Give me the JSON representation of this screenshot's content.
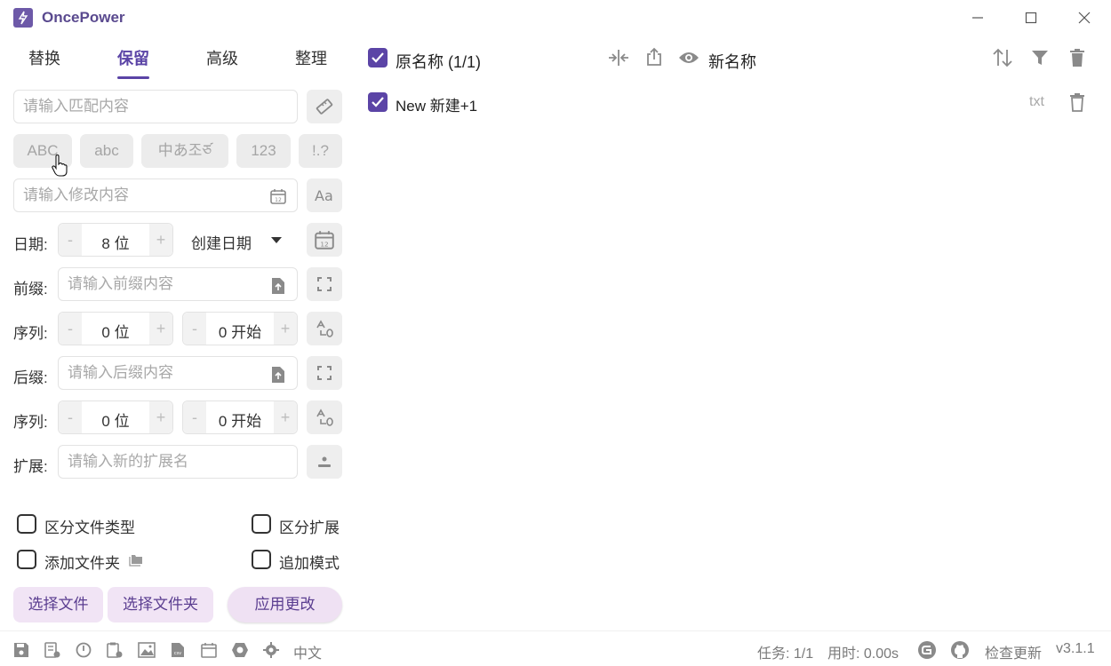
{
  "app": {
    "title": "OncePower",
    "version": "v3.1.1"
  },
  "tabs": [
    {
      "label": "替换"
    },
    {
      "label": "保留"
    },
    {
      "label": "高级"
    },
    {
      "label": "整理"
    }
  ],
  "active_tab": "保留",
  "match_input": {
    "placeholder": "请输入匹配内容",
    "value": ""
  },
  "chips": [
    "ABC",
    "abc",
    "中あ조ཙ",
    "123",
    "!.?"
  ],
  "modify_input": {
    "placeholder": "请输入修改内容",
    "value": ""
  },
  "date": {
    "label": "日期:",
    "minus": "-",
    "value": "8 位",
    "plus": "+",
    "type_selected": "创建日期"
  },
  "prefix": {
    "label": "前缀:",
    "placeholder": "请输入前缀内容"
  },
  "prefix_seq": {
    "label": "序列:",
    "digits": "0 位",
    "start": "0 开始",
    "minus": "-",
    "plus": "+"
  },
  "suffix": {
    "label": "后缀:",
    "placeholder": "请输入后缀内容"
  },
  "suffix_seq": {
    "label": "序列:",
    "digits": "0 位",
    "start": "0 开始",
    "minus": "-",
    "plus": "+"
  },
  "extension": {
    "label": "扩展:",
    "placeholder": "请输入新的扩展名"
  },
  "options": {
    "distinguish_file_type": "区分文件类型",
    "distinguish_extension": "区分扩展",
    "add_folder": "添加文件夹",
    "append_mode": "追加模式"
  },
  "buttons": {
    "select_files": "选择文件",
    "select_folder": "选择文件夹",
    "apply": "应用更改"
  },
  "list_header": {
    "original": "原名称 (1/1)",
    "new": "新名称"
  },
  "files": [
    {
      "name": "New 新建+1",
      "ext": "txt",
      "checked": true
    }
  ],
  "status": {
    "language": "中文",
    "tasks": "任务: 1/1",
    "time": "用时: 0.00s",
    "check_update": "检查更新"
  },
  "colors": {
    "accent": "#5b44a6",
    "button_bg": "#f1e4f5",
    "chip_bg": "#ececec"
  }
}
